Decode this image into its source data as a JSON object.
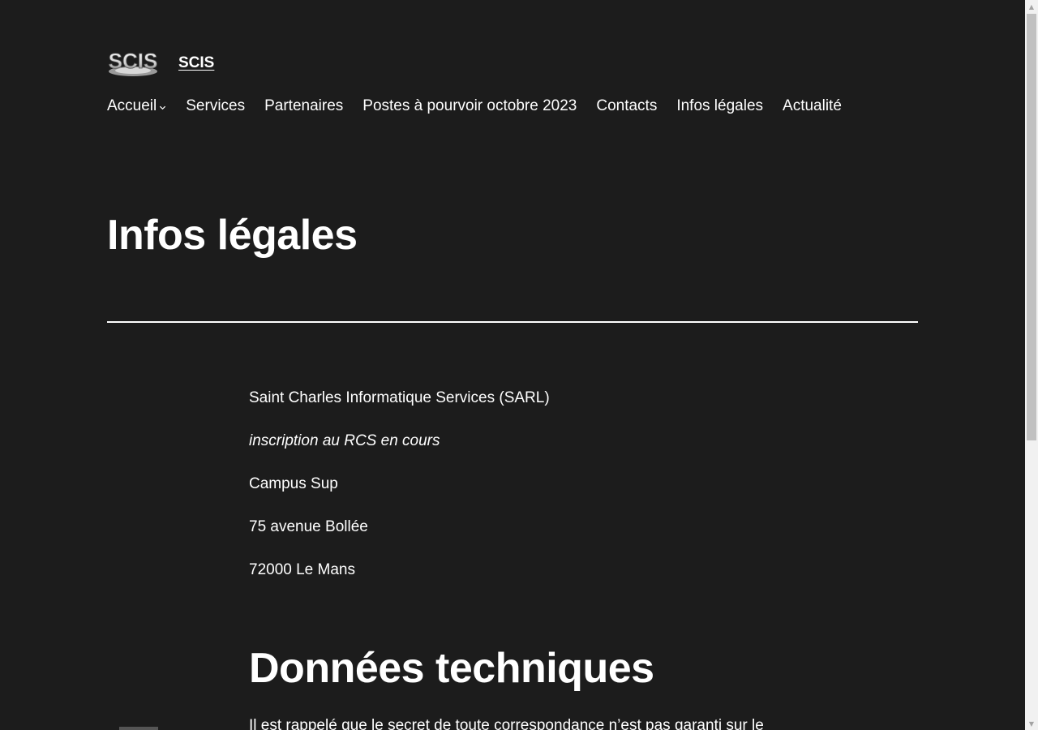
{
  "header": {
    "logo_text": "SCIS",
    "site_title": "SCIS"
  },
  "nav": {
    "items": [
      {
        "label": "Accueil",
        "has_submenu": true
      },
      {
        "label": "Services"
      },
      {
        "label": "Partenaires"
      },
      {
        "label": "Postes à pourvoir octobre 2023"
      },
      {
        "label": "Contacts"
      },
      {
        "label": "Infos légales"
      },
      {
        "label": "Actualité"
      }
    ]
  },
  "main": {
    "title": "Infos légales",
    "paragraphs": [
      "Saint Charles Informatique Services (SARL)",
      "inscription au RCS en cours",
      "Campus Sup",
      "75 avenue Bollée",
      "72000 Le Mans"
    ],
    "section_title": "Données techniques",
    "cutoff_text": "Il est rappelé que le secret de toute correspondance n’est pas garanti sur le"
  },
  "colors": {
    "background": "#1c1c1c",
    "text": "#ffffff"
  }
}
